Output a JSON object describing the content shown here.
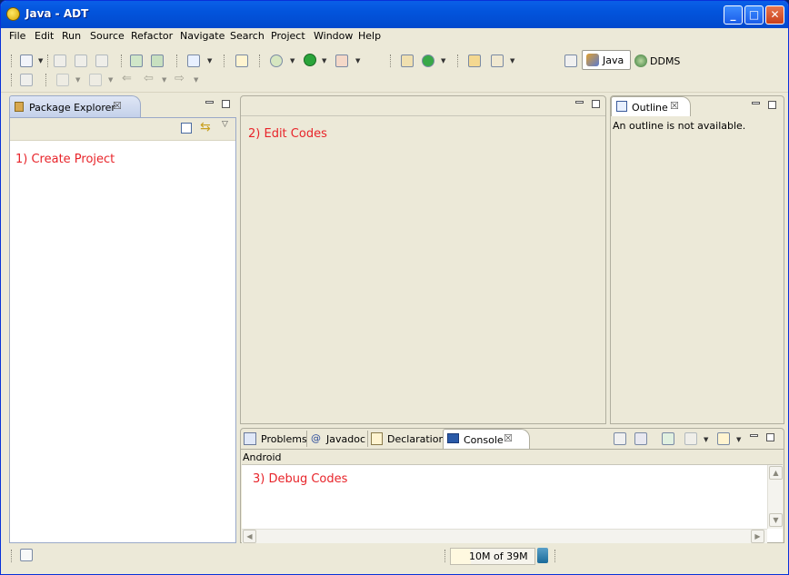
{
  "window": {
    "title": "Java - ADT"
  },
  "menubar": [
    "File",
    "Edit",
    "Run",
    "Source",
    "Refactor",
    "Navigate",
    "Search",
    "Project",
    "Window",
    "Help"
  ],
  "perspectives": {
    "java": "Java",
    "ddms": "DDMS"
  },
  "package_explorer": {
    "tab_label": "Package Explorer",
    "annotation": "1) Create Project"
  },
  "editor": {
    "annotation": "2) Edit Codes"
  },
  "outline": {
    "tab_label": "Outline",
    "message": "An outline is not available."
  },
  "bottom_panel": {
    "tabs": [
      "Problems",
      "Javadoc",
      "Declaration",
      "Console"
    ],
    "console_title": "Android",
    "annotation": "3) Debug Codes"
  },
  "status": {
    "heap": "10M of 39M"
  },
  "colors": {
    "titlebar": "#0254dc",
    "annotation": "#e8242a",
    "chrome": "#ece9d8"
  },
  "icons": [
    "new-icon",
    "save-icon",
    "save-all-icon",
    "print-icon",
    "debug-icon",
    "run-icon",
    "external-tools-icon",
    "open-type-icon",
    "search-icon",
    "back-icon",
    "forward-icon",
    "open-perspective-icon",
    "java-perspective-icon",
    "ddms-perspective-icon",
    "collapse-all-icon",
    "link-editor-icon",
    "view-menu-icon",
    "garbage-collect-icon"
  ]
}
